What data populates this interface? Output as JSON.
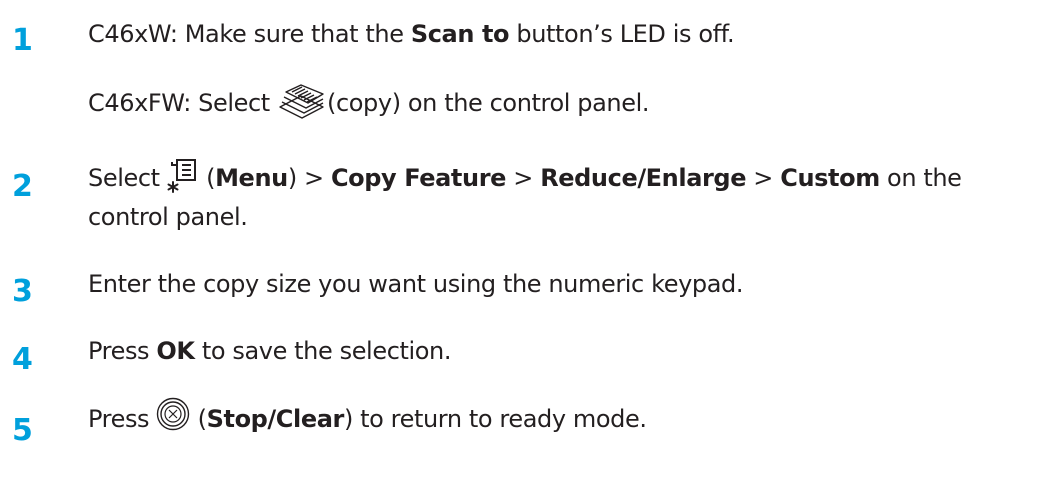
{
  "steps": [
    {
      "number": "1",
      "line1": {
        "a": "C46xW: Make sure that the ",
        "b": "Scan to",
        "c": " button’s LED is off."
      },
      "line2": {
        "a": "C46xFW: Select ",
        "icon": "copy-icon",
        "c": "(copy) on the control panel."
      }
    },
    {
      "number": "2",
      "a": "Select ",
      "icon": "menu-icon",
      "b": " (",
      "menu": "Menu",
      "c": ") > ",
      "feature": "Copy Feature",
      "d": " > ",
      "reduce": "Reduce/Enlarge",
      "e": " > ",
      "custom": "Custom",
      "f": " on the control panel."
    },
    {
      "number": "3",
      "text": "Enter the copy size you want using the numeric keypad."
    },
    {
      "number": "4",
      "a": "Press ",
      "ok": "OK",
      "b": " to save the selection."
    },
    {
      "number": "5",
      "a": "Press ",
      "icon": "stop-clear-icon",
      "b": " (",
      "stop": "Stop/Clear",
      "c": ") to return to ready mode."
    }
  ],
  "colors": {
    "step_number": "#00a0dc",
    "text": "#231f20"
  }
}
